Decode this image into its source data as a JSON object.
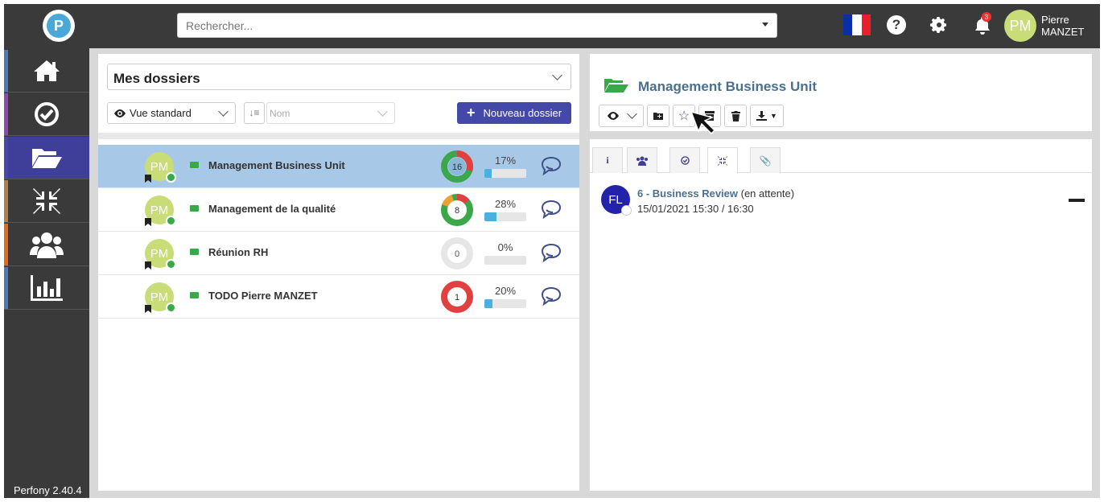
{
  "topbar": {
    "logo_letter": "P",
    "search_placeholder": "Rechercher...",
    "notifications_count": "3",
    "user_initials": "PM",
    "user_first": "Pierre",
    "user_last": "MANZET",
    "flag_colors": [
      "#0a2ea8",
      "#ffffff",
      "#e8202a"
    ]
  },
  "sidebar": {
    "items": [
      {
        "icon": "home-icon",
        "stripe": "#4a7ab8"
      },
      {
        "icon": "check-circle-icon",
        "stripe": "#8a4ab0"
      },
      {
        "icon": "folder-open-icon",
        "stripe": "#4448a8",
        "active": true
      },
      {
        "icon": "compress-arrows-icon",
        "stripe": "#b08050"
      },
      {
        "icon": "users-icon",
        "stripe": "#e06a20"
      },
      {
        "icon": "bar-chart-icon",
        "stripe": "#4a7ab8"
      }
    ],
    "version": "Perfony 2.40.4"
  },
  "left": {
    "title": "Mes dossiers",
    "view_label": "Vue standard",
    "sort_placeholder": "Nom",
    "new_button": "Nouveau dossier",
    "rows": [
      {
        "initials": "PM",
        "name": "Management Business Unit",
        "count": "16",
        "pct": "17%",
        "progress": 0.17,
        "selected": true
      },
      {
        "initials": "PM",
        "name": "Management de la qualité",
        "count": "8",
        "pct": "28%",
        "progress": 0.28
      },
      {
        "initials": "PM",
        "name": "Réunion RH",
        "count": "0",
        "pct": "0%",
        "progress": 0.0
      },
      {
        "initials": "PM",
        "name": "TODO Pierre MANZET",
        "count": "1",
        "pct": "20%",
        "progress": 0.2
      }
    ]
  },
  "right": {
    "title": "Management Business Unit",
    "meeting": {
      "initials": "FL",
      "title": "6 - Business Review",
      "status": " (en attente)",
      "date": "15/01/2021 15:30 / 16:30"
    }
  }
}
